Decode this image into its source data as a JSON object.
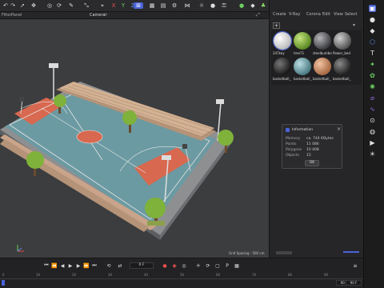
{
  "toolbar": {
    "icons": [
      "undo-icon",
      "redo-icon",
      "select-icon",
      "move-icon",
      "rotate-icon",
      "scale-icon",
      "x-axis",
      "y-axis",
      "z-axis",
      "coord-icon",
      "render-icon",
      "render-view-icon",
      "render-settings-icon"
    ],
    "axes": {
      "x": "X",
      "y": "Y",
      "z": "Z"
    }
  },
  "viewport_menu": {
    "filter": "Filter",
    "panel": "Panel"
  },
  "viewport": {
    "camera_label": "Camera",
    "grid_spacing": "Grid Spacing : 500 cm"
  },
  "right_menu": {
    "create": "Create",
    "vray": "V-Ray",
    "corona": "Corona",
    "edit": "Edit",
    "view": "View",
    "select": "Select"
  },
  "materials": [
    {
      "label": "247key",
      "color": "#e8e8e8"
    },
    {
      "label": "tree71",
      "color": "#7fb23a"
    },
    {
      "label": "steelbumber",
      "color": "#6c6d70"
    },
    {
      "label": "flower_bed",
      "color": "#8a8a8a"
    },
    {
      "label": "basketball_",
      "color": "#2e2e2e"
    },
    {
      "label": "basketball_",
      "color": "#6a9aa0"
    },
    {
      "label": "basketball_",
      "color": "#c98d67"
    },
    {
      "label": "basketball_",
      "color": "#3d3d3d"
    }
  ],
  "info_dialog": {
    "title": "Information",
    "rows": [
      {
        "label": "Memory",
        "value": "ca. 744 KBytes"
      },
      {
        "label": "Points",
        "value": "11 086"
      },
      {
        "label": "Polygons",
        "value": "10 408"
      },
      {
        "label": "Objects",
        "value": "15"
      }
    ],
    "ok": "OK"
  },
  "timeline": {
    "frame_current": "0 F",
    "frame_start": "90 F",
    "frame_end": "90 F",
    "ruler": [
      "0",
      "10",
      "20",
      "30",
      "40",
      "50",
      "60",
      "70",
      "80",
      "90"
    ]
  },
  "colors": {
    "accent": "#4a63d8",
    "court_blue": "#6b9aa2",
    "court_red": "#d8684f",
    "wood": "#c9a48a"
  }
}
